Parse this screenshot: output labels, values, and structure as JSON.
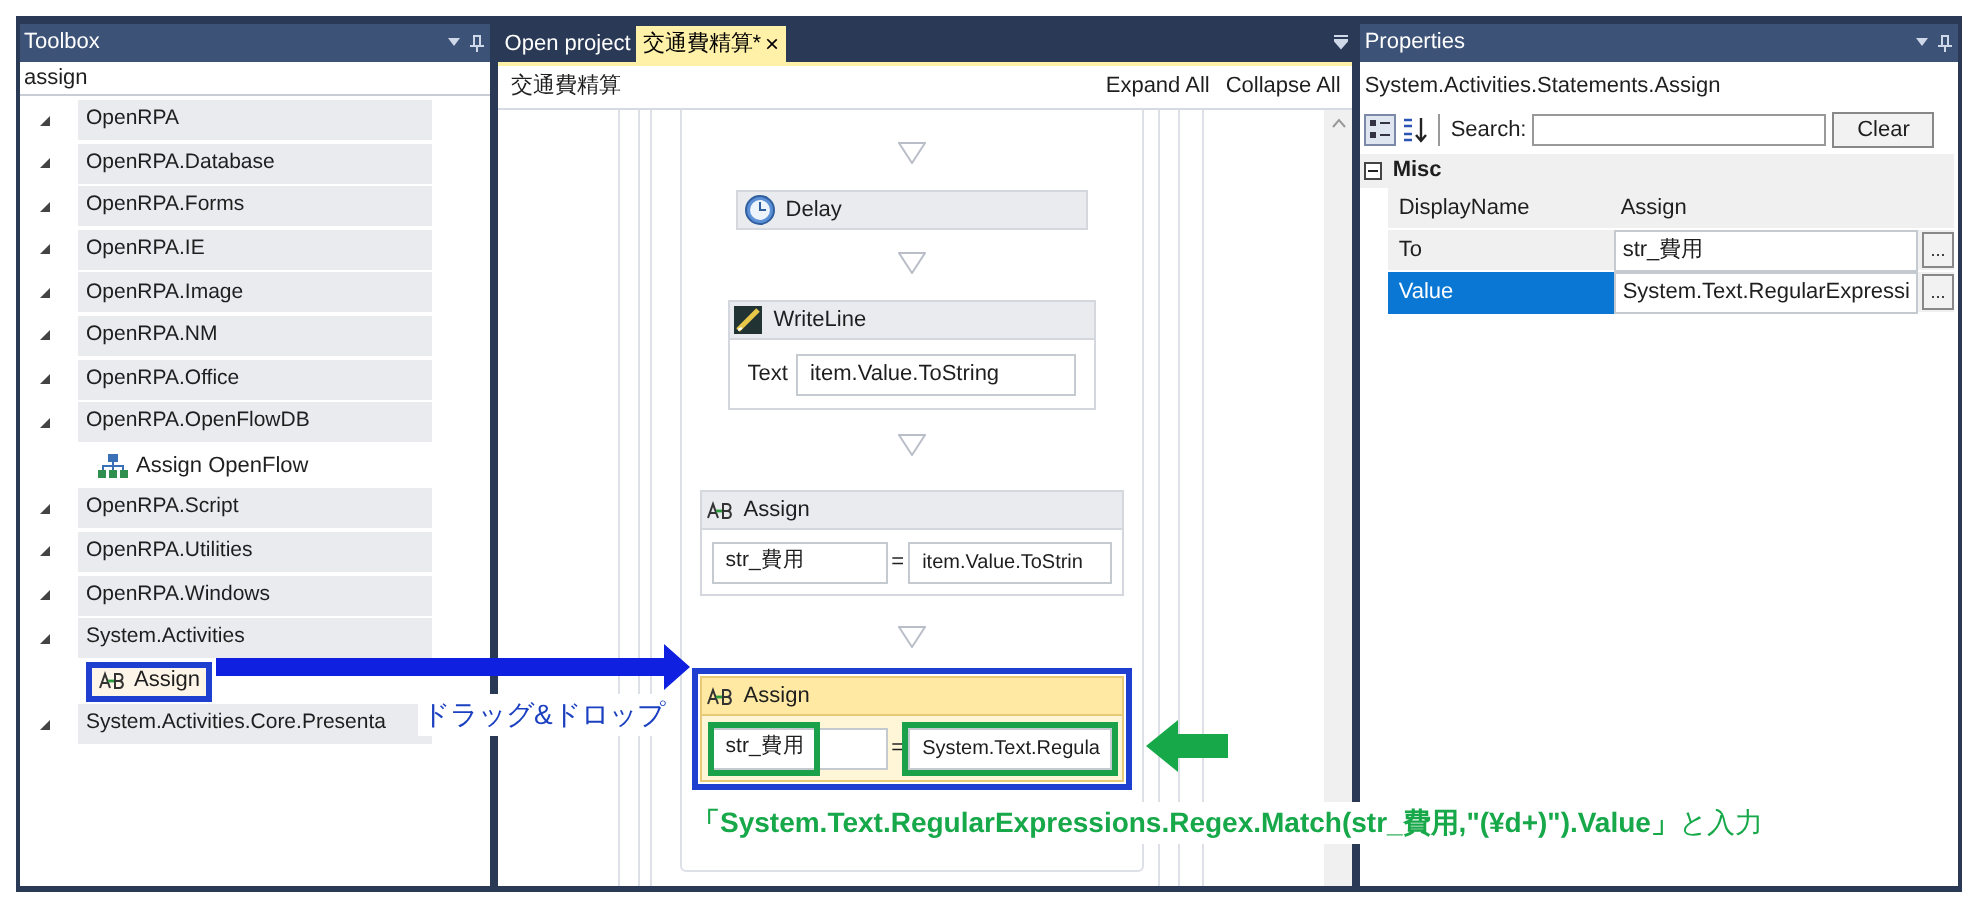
{
  "toolbox": {
    "title": "Toolbox",
    "search": "assign",
    "groups": [
      {
        "label": "OpenRPA",
        "expanded": true
      },
      {
        "label": "OpenRPA.Database",
        "expanded": true
      },
      {
        "label": "OpenRPA.Forms",
        "expanded": true
      },
      {
        "label": "OpenRPA.IE",
        "expanded": true
      },
      {
        "label": "OpenRPA.Image",
        "expanded": true
      },
      {
        "label": "OpenRPA.NM",
        "expanded": true
      },
      {
        "label": "OpenRPA.Office",
        "expanded": true
      },
      {
        "label": "OpenRPA.OpenFlowDB",
        "expanded": true,
        "children": [
          {
            "kind": "flow",
            "label": "Assign OpenFlow",
            "selected": false,
            "annotated": false
          }
        ]
      },
      {
        "label": "OpenRPA.Script",
        "expanded": true
      },
      {
        "label": "OpenRPA.Utilities",
        "expanded": true
      },
      {
        "label": "OpenRPA.Windows",
        "expanded": true
      },
      {
        "label": "System.Activities",
        "expanded": true,
        "children": [
          {
            "kind": "assign",
            "label": "Assign",
            "selected": true,
            "annotated": true
          }
        ]
      },
      {
        "label": "System.Activities.Core.Presenta",
        "expanded": true
      }
    ]
  },
  "document": {
    "tabs": [
      {
        "label": "Open project",
        "selected": false
      },
      {
        "label": "交通費精算*",
        "selected": true,
        "close": "×"
      }
    ],
    "breadcrumb": "交通費精算",
    "actions": [
      "Expand All",
      "Collapse All"
    ],
    "activities": [
      {
        "kind": "delay",
        "title": "Delay"
      },
      {
        "kind": "writeline",
        "title": "WriteLine",
        "label": "Text",
        "value": "item.Value.ToString"
      },
      {
        "kind": "assign",
        "title": "Assign",
        "to": "str_費用",
        "operator": "=",
        "value": "item.Value.ToStrin",
        "selected": false,
        "annotated": false
      },
      {
        "kind": "assign",
        "title": "Assign",
        "to": "str_費用",
        "operator": "=",
        "value": "System.Text.Regula",
        "selected": true,
        "annotated": true
      }
    ]
  },
  "properties": {
    "title": "Properties",
    "type_name": "System.Activities.Statements.Assign",
    "search_label": "Search:",
    "clear_button": "Clear",
    "category": {
      "label": "Misc",
      "expanded": true
    },
    "rows": [
      {
        "name": "DisplayName",
        "value": "Assign",
        "selected": false
      },
      {
        "name": "To",
        "value": "str_費用",
        "selected": false,
        "button": "..."
      },
      {
        "name": "Value",
        "value": "System.Text.RegularExpressi",
        "selected": true,
        "button": "..."
      }
    ]
  },
  "annotations": {
    "drag_label": "ドラッグ&ドロップ",
    "input_note": "**「System.Text.RegularExpressions.Regex.Match(str_費用,\"(¥d+)\").Value」**と入力"
  }
}
